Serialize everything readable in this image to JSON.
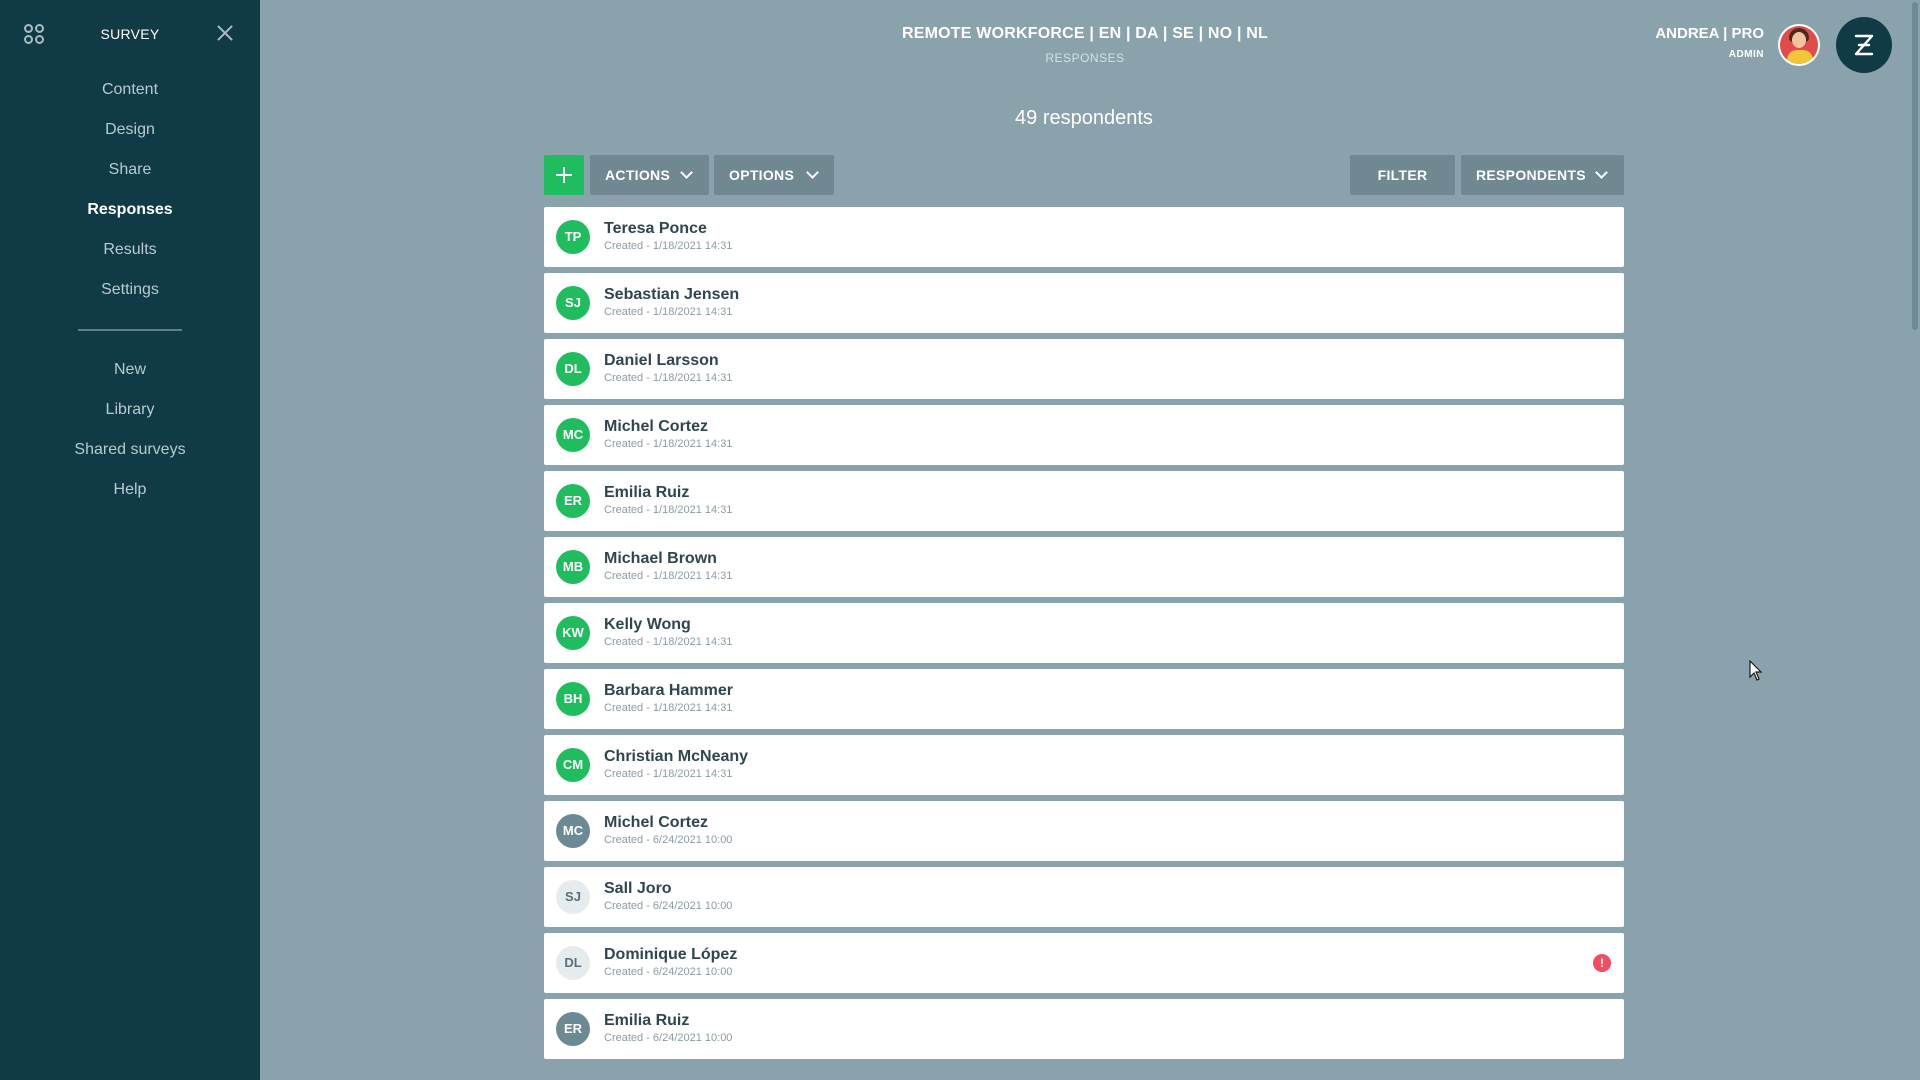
{
  "sidebar": {
    "title": "SURVEY",
    "main_items": [
      {
        "label": "Content",
        "active": false
      },
      {
        "label": "Design",
        "active": false
      },
      {
        "label": "Share",
        "active": false
      },
      {
        "label": "Responses",
        "active": true
      },
      {
        "label": "Results",
        "active": false
      },
      {
        "label": "Settings",
        "active": false
      }
    ],
    "secondary_items": [
      {
        "label": "New"
      },
      {
        "label": "Library"
      },
      {
        "label": "Shared surveys"
      },
      {
        "label": "Help"
      }
    ]
  },
  "header": {
    "title": "REMOTE WORKFORCE | EN | DA | SE | NO | NL",
    "subtitle": "RESPONSES",
    "user_name": "ANDREA | PRO",
    "user_role": "ADMIN"
  },
  "main": {
    "count_text": "49 respondents",
    "toolbar": {
      "actions_label": "ACTIONS",
      "options_label": "OPTIONS",
      "filter_label": "FILTER",
      "respondents_label": "RESPONDENTS"
    },
    "rows": [
      {
        "initials": "TP",
        "name": "Teresa Ponce",
        "created": "Created - 1/18/2021 14:31",
        "style": "green",
        "alert": ""
      },
      {
        "initials": "SJ",
        "name": "Sebastian Jensen",
        "created": "Created - 1/18/2021 14:31",
        "style": "green",
        "alert": ""
      },
      {
        "initials": "DL",
        "name": "Daniel Larsson",
        "created": "Created - 1/18/2021 14:31",
        "style": "green",
        "alert": ""
      },
      {
        "initials": "MC",
        "name": "Michel Cortez",
        "created": "Created - 1/18/2021 14:31",
        "style": "green",
        "alert": ""
      },
      {
        "initials": "ER",
        "name": "Emilia Ruiz",
        "created": "Created - 1/18/2021 14:31",
        "style": "green",
        "alert": ""
      },
      {
        "initials": "MB",
        "name": "Michael Brown",
        "created": "Created - 1/18/2021 14:31",
        "style": "green",
        "alert": ""
      },
      {
        "initials": "KW",
        "name": "Kelly Wong",
        "created": "Created - 1/18/2021 14:31",
        "style": "green",
        "alert": ""
      },
      {
        "initials": "BH",
        "name": "Barbara Hammer",
        "created": "Created - 1/18/2021 14:31",
        "style": "green",
        "alert": ""
      },
      {
        "initials": "CM",
        "name": "Christian McNeany",
        "created": "Created - 1/18/2021 14:31",
        "style": "green",
        "alert": ""
      },
      {
        "initials": "MC",
        "name": "Michel Cortez",
        "created": "Created - 6/24/2021 10:00",
        "style": "gray",
        "alert": ""
      },
      {
        "initials": "SJ",
        "name": "Sall Joro",
        "created": "Created - 6/24/2021 10:00",
        "style": "light",
        "alert": ""
      },
      {
        "initials": "DL",
        "name": "Dominique López",
        "created": "Created - 6/24/2021 10:00",
        "style": "light",
        "alert": "!"
      },
      {
        "initials": "ER",
        "name": "Emilia Ruiz",
        "created": "Created - 6/24/2021 10:00",
        "style": "gray",
        "alert": ""
      }
    ]
  },
  "colors": {
    "sidebar_bg": "#0f3a46",
    "page_bg": "#8aa2ab",
    "accent_green": "#1fbd5e",
    "toolbar_button": "#6f8891",
    "alert_red": "#ef4e63"
  },
  "icons": [
    "apps-grid-icon",
    "close-icon",
    "plus-icon",
    "chevron-down-icon",
    "alert-icon",
    "brand-logo-icon"
  ]
}
